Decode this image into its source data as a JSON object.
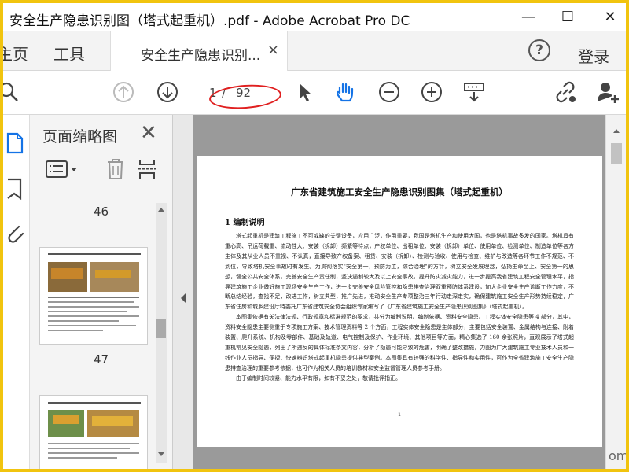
{
  "window": {
    "title": "安全生产隐患识别图（塔式起重机）.pdf - Adobe Acrobat Pro DC",
    "minimize": "—",
    "maximize": "☐",
    "close": "✕"
  },
  "menubar": {
    "home": "主页",
    "tools": "工具",
    "doc_tab": "安全生产隐患识别...",
    "doc_tab_close": "×",
    "help": "?",
    "login": "登录"
  },
  "toolbar": {
    "current_page": "1",
    "separator": "/",
    "total_pages": "92"
  },
  "thumbnails": {
    "title": "页面缩略图",
    "close": "✕",
    "pages": [
      "46",
      "47"
    ]
  },
  "document": {
    "heading": "广东省建筑施工安全生产隐患识别图集（塔式起重机）",
    "section": "1 编制说明",
    "paragraphs": [
      "塔式起重机是建筑工程施工不可或缺的关键设备，应用广泛，作用重要，我国是塔机生产和使用大国，也是塔机事故多发的国家。塔机具有重心高、吊运荷载重、流动性大、安装（拆卸）频繁等特点，产权单位、出租单位、安装（拆卸）单位、使用单位、检测单位、制造单位等各方主体及其从业人员不重视、不认真，直接导致产权备案、租赁、安装（拆卸）、检测与验收、使用与检查、维护与改造等各环节工作不规范、不到位，导致塔机安全事故时有发生。为贯彻落实\"安全第一，预防为主，综合治理\"的方针，树立安全发展理念，弘扬生命至上、安全第一的思想，健全公共安全体系，完善安全生产责任制，坚决遏制较大及以上安全事故，提升防灾减灾能力，进一步提高我省建筑工程安全管理水平，指导建筑施工企业做好施工现场安全生产工作，进一步完善安全风险管控和隐患排查治理双重预防体系建设，加大企业安全生产诊断工作力度，不断总结经验，查找不足，改进工作，树立典型，推广先进，推动安全生产专项整治三年行动走深走实，确保建筑施工安全生产形势持续稳定，广东省住房和城乡建设厅特委托广东省建筑安全协会组织专家编写了《广东省建筑施工安全生产隐患识别图集》（塔式起重机）。",
      "本图集依据有关法律法规、行政规章和标准规范的要求，共分为编制说明、编制依据、资料安全隐患、工程实体安全隐患等 4 部分，其中，资料安全隐患主要侧重于专项施工方案、技术管理资料等 2 个方面，工程实体安全隐患是主体部分，主要包括安全装置、金属结构与连接、附着装置、爬升系统、机构及零部件、基础及轨道、电气控制及保护、作业环境、其他项目等方面，精心集选了 160 余张照片，直观展示了塔式起重机常见安全隐患，列出了所违反的具体标准条文内容，分析了隐患可能导致的危害，明确了整改措施，力图为广大建筑施工专业技术人员和一线作业人员指导、便捷、快速辨识塔式起重机隐患提供典型案例。本图集具有较强的科学性、指导性和实用性，可作为全省建筑施工安全生产隐患排查治理的重要参考依据，也可作为相关人员的培训教材和安全监督管理人员参考手册。",
      "由于编制时间较紧、能力水平有限，如有不妥之处，敬请批评指正。"
    ],
    "page_number": "1"
  },
  "colors": {
    "screenshot_border": "#f1c40f",
    "annotation_ellipse": "#e02020",
    "doc_background": "#9a9a9a"
  },
  "watermark": "om"
}
